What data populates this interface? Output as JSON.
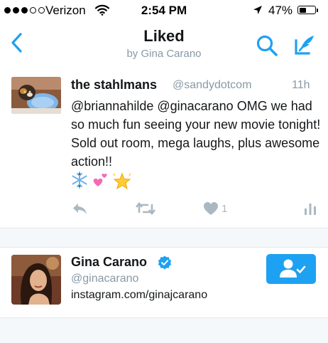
{
  "status_bar": {
    "signal_bars_filled": 3,
    "signal_bars_total": 5,
    "carrier": "Verizon",
    "time": "2:54 PM",
    "battery_text": "47%",
    "battery_level": 0.47
  },
  "nav": {
    "title": "Liked",
    "subtitle": "by Gina Carano",
    "accent_color": "#1da1f2"
  },
  "tweet": {
    "display_name": "the stahlmans",
    "handle": "@sandydotcom",
    "timestamp": "11h",
    "text": "@briannahilde @ginacarano OMG we had so much fun seeing your new movie tonight! Sold out room, mega laughs, plus awesome action!!",
    "emojis": [
      "snowflake",
      "two-hearts",
      "glowing-star"
    ],
    "like_count": "1"
  },
  "user_card": {
    "display_name": "Gina Carano",
    "handle": "@ginacarano",
    "link": "instagram.com/ginajcarano",
    "verified": true,
    "following": true
  }
}
